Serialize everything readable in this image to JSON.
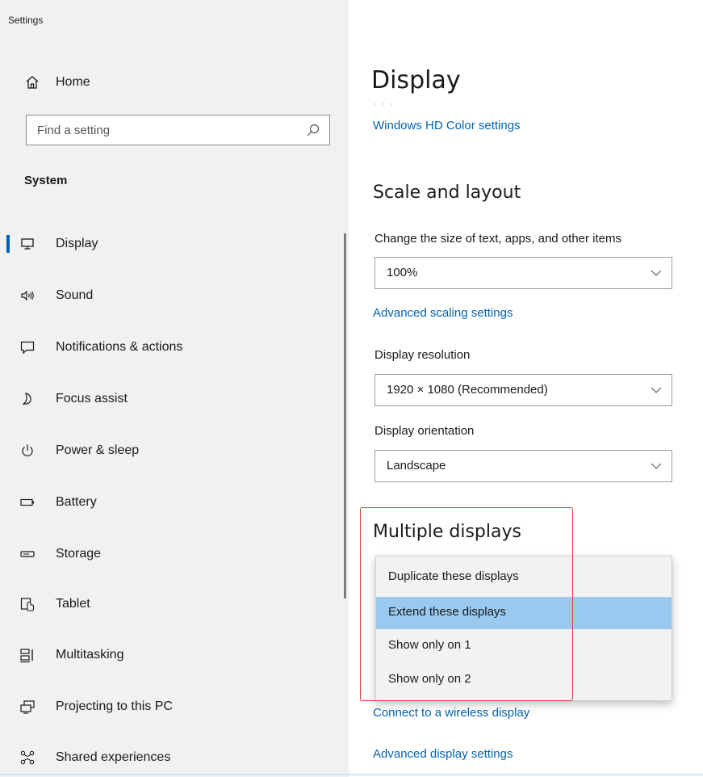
{
  "window": {
    "title": "Settings"
  },
  "sidebar": {
    "home_label": "Home",
    "search_placeholder": "Find a setting",
    "section": "System",
    "items": [
      {
        "label": "Display",
        "icon": "monitor-icon",
        "selected": true
      },
      {
        "label": "Sound",
        "icon": "speaker-icon"
      },
      {
        "label": "Notifications & actions",
        "icon": "notification-icon"
      },
      {
        "label": "Focus assist",
        "icon": "moon-icon"
      },
      {
        "label": "Power & sleep",
        "icon": "power-icon"
      },
      {
        "label": "Battery",
        "icon": "battery-icon"
      },
      {
        "label": "Storage",
        "icon": "storage-icon"
      },
      {
        "label": "Tablet",
        "icon": "tablet-icon"
      },
      {
        "label": "Multitasking",
        "icon": "multitasking-icon"
      },
      {
        "label": "Projecting to this PC",
        "icon": "projecting-icon"
      },
      {
        "label": "Shared experiences",
        "icon": "shared-icon"
      }
    ]
  },
  "main": {
    "title": "Display",
    "hd_color_link": "Windows HD Color settings",
    "scale_heading": "Scale and layout",
    "scale_label": "Change the size of text, apps, and other items",
    "scale_value": "100%",
    "advanced_scaling_link": "Advanced scaling settings",
    "resolution_label": "Display resolution",
    "resolution_value": "1920 × 1080 (Recommended)",
    "orientation_label": "Display orientation",
    "orientation_value": "Landscape",
    "multiple_heading": "Multiple displays",
    "multiple_options": [
      "Duplicate these displays",
      "Extend these displays",
      "Show only on 1",
      "Show only on 2"
    ],
    "multiple_selected": "Extend these displays",
    "wireless_link": "Connect to a wireless display",
    "advanced_display_link": "Advanced display settings"
  },
  "colors": {
    "accent": "#0063b1",
    "sidebar_bg": "#f1f1f1",
    "selected_option_bg": "#99c9ef",
    "highlight_border": "#e23b3b"
  }
}
